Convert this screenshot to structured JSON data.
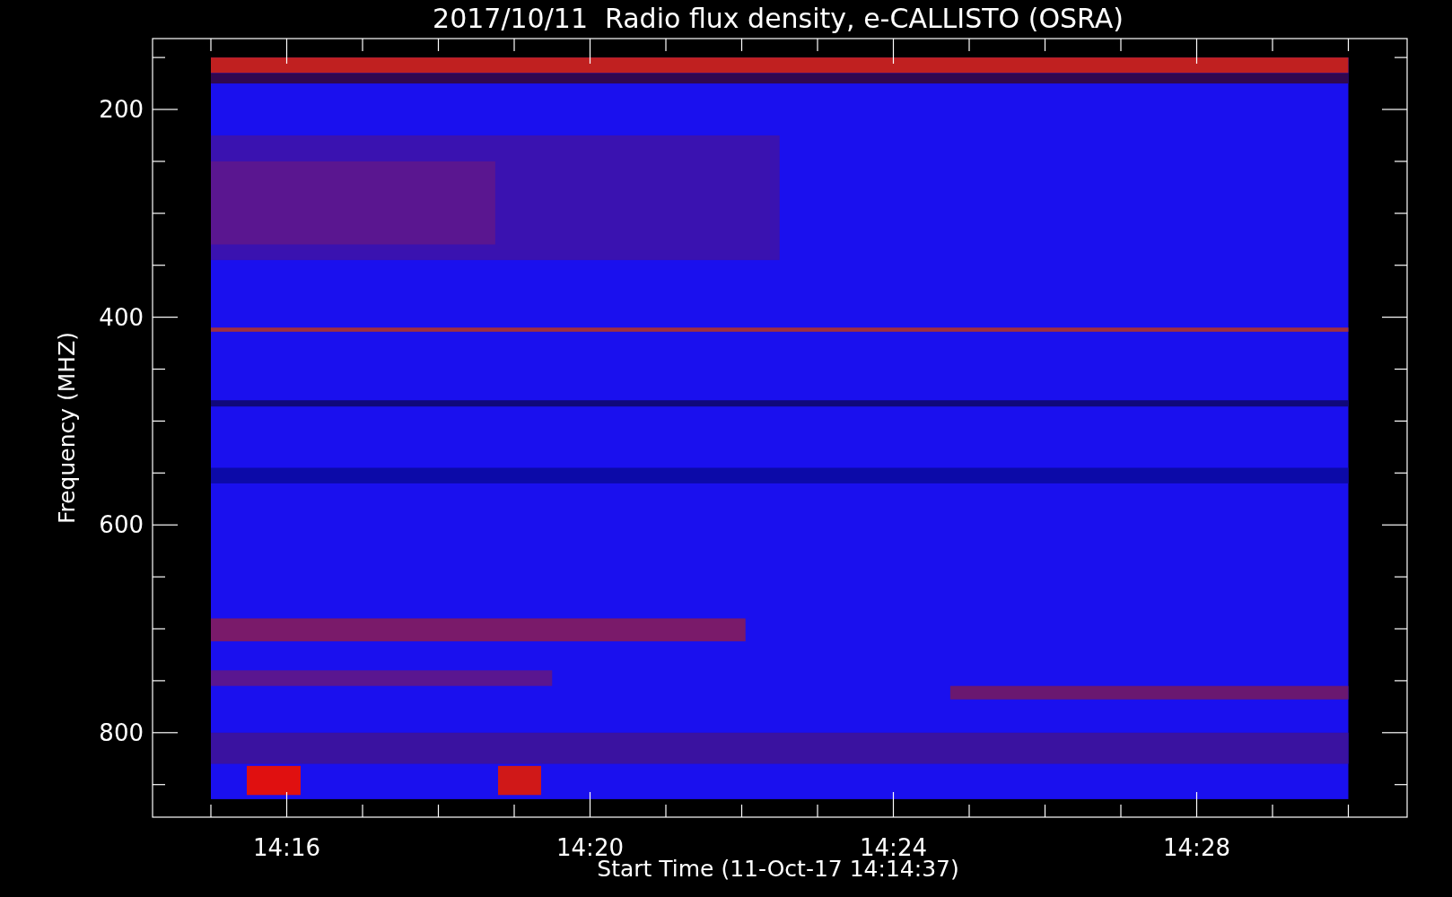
{
  "title": "2017/10/11  Radio flux density, e-CALLISTO (OSRA)",
  "y_axis": {
    "label": "Frequency (MHZ)",
    "ticks": [
      "200",
      "400",
      "600",
      "800"
    ]
  },
  "x_axis": {
    "label": "Start Time (11-Oct-17 14:14:37)",
    "ticks": [
      "14:16",
      "14:20",
      "14:24",
      "14:28"
    ]
  }
}
